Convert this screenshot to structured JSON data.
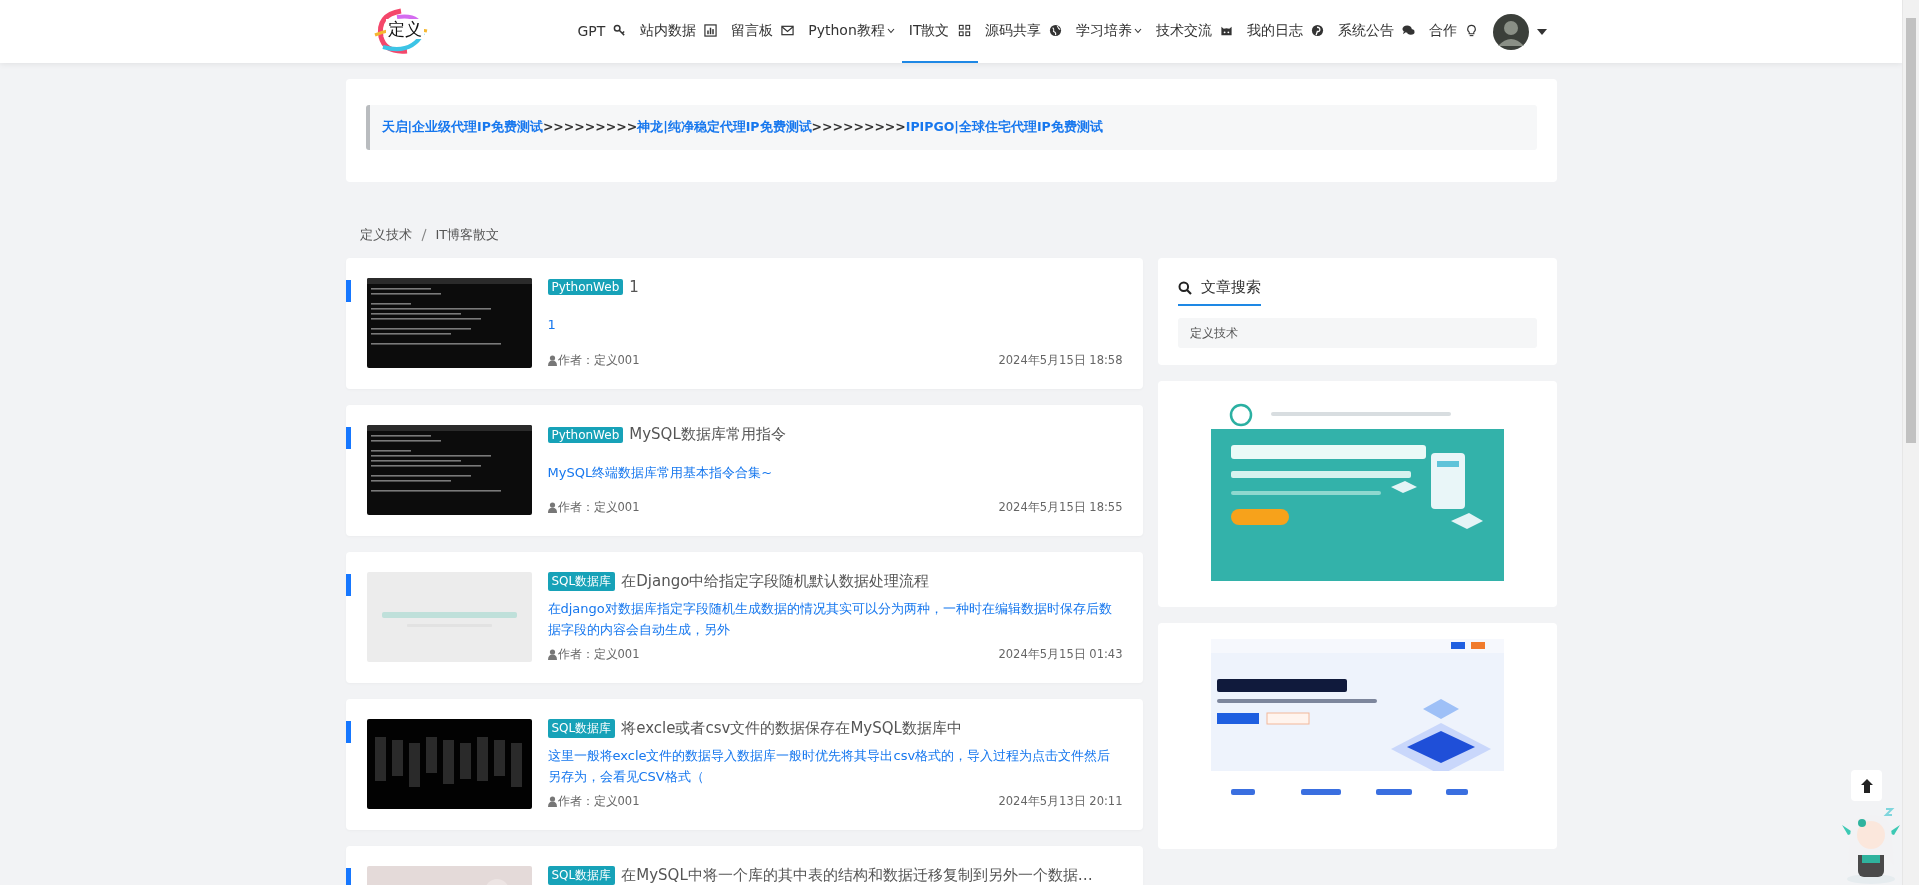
{
  "logo": "定义",
  "nav": [
    {
      "label": "GPT",
      "has_menu": false,
      "selected": false
    },
    {
      "label": "站内数据",
      "has_menu": false,
      "selected": false
    },
    {
      "label": "留言板",
      "has_menu": false,
      "selected": false
    },
    {
      "label": "Python教程",
      "has_menu": true,
      "selected": false
    },
    {
      "label": "IT散文",
      "has_menu": false,
      "selected": true
    },
    {
      "label": "源码共享",
      "has_menu": false,
      "selected": false
    },
    {
      "label": "学习培养",
      "has_menu": true,
      "selected": false
    },
    {
      "label": "技术交流",
      "has_menu": false,
      "selected": false
    },
    {
      "label": "我的日志",
      "has_menu": false,
      "selected": false
    },
    {
      "label": "系统公告",
      "has_menu": false,
      "selected": false
    },
    {
      "label": "合作",
      "has_menu": false,
      "selected": false
    }
  ],
  "promo": {
    "links": [
      "天启|企业级代理IP免费测试",
      "神龙|纯净稳定代理IP免费测试",
      "IPIPGO|全球住宅代理IP免费测试"
    ],
    "separator": ">>>>>>>>>"
  },
  "breadcrumb": [
    "定义技术",
    "IT博客散文"
  ],
  "articles": [
    {
      "category": "PythonWeb",
      "title": "1",
      "summary": "1",
      "author": "作者：定义001",
      "date": "2024年5月15日 18:58"
    },
    {
      "category": "PythonWeb",
      "title": "MySQL数据库常用指令",
      "summary": "MySQL终端数据库常用基本指令合集~",
      "author": "作者：定义001",
      "date": "2024年5月15日 18:55"
    },
    {
      "category": "SQL数据库",
      "title": "在Django中给指定字段随机默认数据处理流程",
      "summary": "在django对数据库指定字段随机生成数据的情况其实可以分为两种，一种时在编辑数据时保存后数据字段的内容会自动生成，另外",
      "author": "作者：定义001",
      "date": "2024年5月15日 01:43"
    },
    {
      "category": "SQL数据库",
      "title": "将excle或者csv文件的数据保存在MySQL数据库中",
      "summary": "这里一般将excle文件的数据导入数据库一般时优先将其导出csv格式的，导入过程为点击文件然后另存为，会看见CSV格式（",
      "author": "作者：定义001",
      "date": "2024年5月13日 20:11"
    },
    {
      "category": "SQL数据库",
      "title": "在MySQL中将一个库的其中表的结构和数据迁移复制到另外一个数据…"
    }
  ],
  "search": {
    "heading": "文章搜索",
    "placeholder": "定义技术"
  }
}
